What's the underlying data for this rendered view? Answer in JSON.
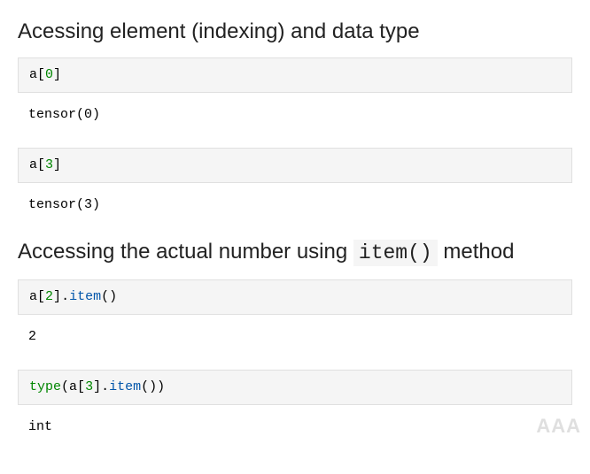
{
  "section1": {
    "heading": "Acessing element (indexing) and data type",
    "cell1": {
      "var": "a",
      "lb": "[",
      "idx": "0",
      "rb": "]"
    },
    "out1": "tensor(0)",
    "cell2": {
      "var": "a",
      "lb": "[",
      "idx": "3",
      "rb": "]"
    },
    "out2": "tensor(3)"
  },
  "section2": {
    "heading_pre": "Accessing the actual number using ",
    "heading_code": "item()",
    "heading_post": " method",
    "cell1": {
      "var": "a",
      "lb": "[",
      "idx": "2",
      "rb": "]",
      "dot": ".",
      "method": "item",
      "call": "()"
    },
    "out1": "2",
    "cell2": {
      "func": "type",
      "open": "(",
      "var": "a",
      "lb": "[",
      "idx": "3",
      "rb": "]",
      "dot": ".",
      "method": "item",
      "call": "()",
      "close": ")"
    },
    "out2": "int"
  },
  "watermark": "AAA"
}
